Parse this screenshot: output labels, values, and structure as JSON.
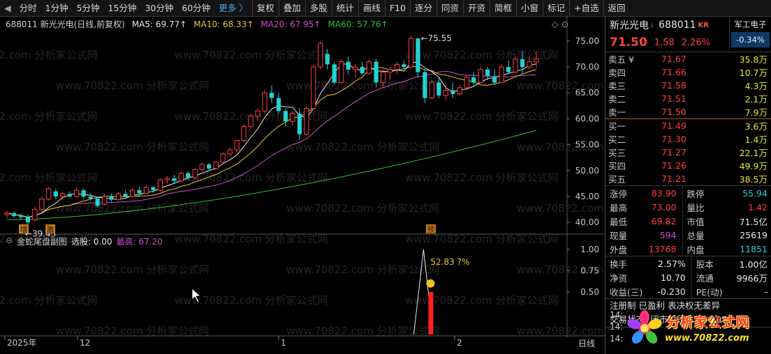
{
  "toolbar": {
    "items": [
      "分时",
      "1分钟",
      "5分钟",
      "15分钟",
      "30分钟",
      "60分钟",
      "更多 〉",
      "复权",
      "叠加",
      "多股",
      "统计",
      "画线",
      "F10",
      "逐分",
      "同资",
      "开资",
      "简框",
      "小窗",
      "标记",
      "+自选",
      "返回"
    ]
  },
  "legend": {
    "title": "688011 新光光电(日线,前复权)",
    "ma5": "MA5: 69.77↑",
    "ma10": "MA10: 68.33↑",
    "ma20": "MA20: 67.95↑",
    "ma60": "MA60: 57.76↑"
  },
  "sub_legend": {
    "name": "金蛇尾盘副图",
    "pick": "选股: 0.00",
    "high": "最高: 67.20"
  },
  "annotations": {
    "high": "75.55",
    "low": "39.43",
    "tag_zeng": "增",
    "tag_ji": "激",
    "tag_yu": "预",
    "sub_note": "52.83 ?%"
  },
  "price_axis": [
    "75.00",
    "70.00",
    "65.00",
    "60.00",
    "55.00",
    "50.00",
    "45.00",
    "40.00"
  ],
  "sub_axis": [
    "1.00",
    "0.75",
    "0.50"
  ],
  "x_axis": {
    "labels": [
      "2025年",
      "12",
      "1",
      "2"
    ],
    "period": "日线"
  },
  "stock": {
    "name": "新光光电",
    "code": "688011",
    "kr": "KR",
    "last": "71.50",
    "chg": "1.58",
    "pct": "2.26%",
    "sector": "军工电子",
    "sector_chg": "-0.34%"
  },
  "orderbook": {
    "asks": [
      {
        "label": "卖五 ¥",
        "price": "71.67",
        "vol": "35.8万"
      },
      {
        "label": "卖四",
        "price": "71.66",
        "vol": "10.7万"
      },
      {
        "label": "卖三",
        "price": "71.58",
        "vol": "4.3万"
      },
      {
        "label": "卖二",
        "price": "71.51",
        "vol": "2.1万"
      },
      {
        "label": "卖一",
        "price": "71.50",
        "vol": "7.9万"
      }
    ],
    "bids": [
      {
        "label": "买一",
        "price": "71.49",
        "vol": "3.6万"
      },
      {
        "label": "买二",
        "price": "71.30",
        "vol": "1.4万"
      },
      {
        "label": "买三",
        "price": "71.27",
        "vol": "22.1万"
      },
      {
        "label": "买四",
        "price": "71.26",
        "vol": "49.9万"
      },
      {
        "label": "买五",
        "price": "71.21",
        "vol": "38.5万"
      }
    ]
  },
  "stats": [
    [
      {
        "k": "涨停",
        "v": "83.90",
        "c": "red"
      },
      {
        "k": "跌停",
        "v": "55.94",
        "c": "green"
      }
    ],
    [
      {
        "k": "最高",
        "v": "73.00",
        "c": "red"
      },
      {
        "k": "量比",
        "v": "1.42",
        "c": "red"
      }
    ],
    [
      {
        "k": "最低",
        "v": "69.82",
        "c": "red"
      },
      {
        "k": "市值",
        "v": "71.5亿",
        "c": "white"
      }
    ],
    [
      {
        "k": "现量",
        "v": "594",
        "c": "purple"
      },
      {
        "k": "总量",
        "v": "25619",
        "c": "white"
      }
    ],
    [
      {
        "k": "外盘",
        "v": "13768",
        "c": "red"
      },
      {
        "k": "内盘",
        "v": "11851",
        "c": "green"
      }
    ]
  ],
  "stats2": [
    [
      {
        "k": "换手",
        "v": "2.57%",
        "c": "white"
      },
      {
        "k": "股本",
        "v": "1.00亿",
        "c": "white"
      }
    ],
    [
      {
        "k": "净资",
        "v": "10.70",
        "c": "white"
      },
      {
        "k": "流通",
        "v": "9966万",
        "c": "white"
      }
    ],
    [
      {
        "k": "收益(三)",
        "v": "-0.230",
        "c": "white"
      },
      {
        "k": "PE(动)",
        "v": "-",
        "c": "white"
      }
    ]
  ],
  "flags": "注册制 已盈利 表决权无差异",
  "trade_status": "交易状态: 闭市阶段 15:30:07",
  "trades": [
    "14:",
    "14:",
    "14:"
  ],
  "logo": {
    "brand": "分析家公式网",
    "url": "www.70822.com"
  },
  "watermark": "www.70822.com 分析家公式网",
  "colors": {
    "up": "#ff4040",
    "down": "#22d2d2",
    "ma5": "#e8e8e8",
    "ma10": "#e8c832",
    "ma20": "#d050d0",
    "ma60": "#30c030"
  },
  "chart_data": {
    "type": "candlestick",
    "ylim": [
      38,
      77
    ],
    "candles": [
      [
        41.5,
        42.2,
        40.8,
        41.8
      ],
      [
        41.8,
        42.0,
        41.0,
        41.2
      ],
      [
        41.2,
        41.8,
        40.6,
        41.0
      ],
      [
        41.0,
        41.5,
        39.4,
        40.0
      ],
      [
        40.5,
        43.0,
        40.2,
        42.5
      ],
      [
        42.5,
        45.0,
        42.0,
        44.5
      ],
      [
        44.5,
        46.8,
        44.2,
        46.5
      ],
      [
        46.0,
        46.5,
        44.5,
        45.0
      ],
      [
        45.0,
        45.8,
        44.3,
        45.5
      ],
      [
        45.5,
        46.0,
        44.8,
        45.0
      ],
      [
        45.0,
        46.8,
        44.8,
        46.2
      ],
      [
        46.2,
        46.5,
        44.6,
        45.0
      ],
      [
        45.0,
        45.6,
        44.2,
        44.6
      ],
      [
        44.6,
        45.0,
        42.8,
        43.2
      ],
      [
        43.5,
        45.5,
        43.2,
        45.0
      ],
      [
        45.0,
        45.6,
        44.0,
        44.4
      ],
      [
        44.4,
        45.8,
        44.2,
        45.5
      ],
      [
        45.5,
        46.2,
        44.8,
        45.0
      ],
      [
        45.0,
        46.5,
        44.8,
        46.2
      ],
      [
        46.2,
        46.8,
        45.2,
        45.6
      ],
      [
        45.6,
        47.2,
        45.4,
        46.8
      ],
      [
        46.8,
        47.0,
        45.8,
        46.2
      ],
      [
        46.2,
        48.5,
        46.0,
        48.2
      ],
      [
        48.2,
        49.0,
        47.5,
        48.5
      ],
      [
        48.5,
        49.2,
        47.6,
        48.0
      ],
      [
        48.0,
        49.8,
        47.8,
        49.5
      ],
      [
        49.5,
        49.8,
        48.2,
        48.6
      ],
      [
        48.6,
        50.5,
        48.4,
        50.2
      ],
      [
        50.2,
        51.5,
        49.8,
        51.2
      ],
      [
        51.2,
        51.5,
        50.0,
        50.4
      ],
      [
        50.4,
        51.8,
        50.2,
        51.6
      ],
      [
        51.6,
        53.5,
        51.4,
        53.2
      ],
      [
        53.2,
        54.5,
        52.8,
        54.0
      ],
      [
        54.0,
        56.0,
        53.5,
        55.8
      ],
      [
        55.8,
        59.0,
        55.5,
        58.5
      ],
      [
        58.5,
        61.0,
        58.0,
        60.5
      ],
      [
        60.5,
        62.0,
        59.5,
        61.5
      ],
      [
        61.5,
        65.5,
        61.0,
        65.0
      ],
      [
        65.0,
        66.5,
        63.0,
        64.0
      ],
      [
        64.0,
        65.0,
        61.0,
        61.5
      ],
      [
        61.5,
        62.0,
        58.5,
        59.5
      ],
      [
        59.5,
        61.5,
        58.8,
        61.0
      ],
      [
        61.0,
        62.0,
        56.0,
        57.0
      ],
      [
        57.0,
        62.5,
        56.8,
        62.0
      ],
      [
        62.0,
        70.5,
        61.8,
        70.0
      ],
      [
        70.0,
        75.0,
        69.5,
        74.5
      ],
      [
        72.5,
        73.5,
        69.5,
        70.5
      ],
      [
        70.5,
        71.0,
        66.5,
        67.0
      ],
      [
        67.0,
        71.5,
        66.8,
        71.0
      ],
      [
        71.0,
        72.0,
        68.5,
        69.5
      ],
      [
        69.5,
        70.5,
        68.0,
        70.0
      ],
      [
        70.0,
        71.0,
        68.5,
        68.8
      ],
      [
        68.8,
        71.5,
        68.5,
        71.0
      ],
      [
        71.0,
        71.5,
        66.0,
        67.0
      ],
      [
        67.0,
        69.5,
        66.0,
        69.0
      ],
      [
        69.0,
        70.0,
        67.5,
        69.5
      ],
      [
        69.5,
        71.0,
        68.5,
        70.5
      ],
      [
        70.5,
        71.2,
        69.5,
        70.0
      ],
      [
        70.0,
        76.0,
        69.8,
        75.5
      ],
      [
        75.5,
        75.55,
        68.0,
        69.0
      ],
      [
        69.0,
        69.5,
        63.0,
        64.0
      ],
      [
        64.0,
        67.5,
        63.8,
        67.0
      ],
      [
        67.0,
        68.0,
        64.0,
        64.5
      ],
      [
        64.5,
        66.5,
        63.5,
        65.5
      ],
      [
        65.5,
        67.0,
        64.0,
        64.8
      ],
      [
        64.8,
        66.5,
        64.5,
        66.0
      ],
      [
        66.0,
        68.5,
        65.5,
        68.0
      ],
      [
        68.0,
        69.0,
        66.5,
        67.0
      ],
      [
        67.0,
        70.0,
        66.8,
        69.5
      ],
      [
        69.5,
        70.0,
        67.5,
        68.2
      ],
      [
        68.2,
        69.5,
        66.5,
        67.0
      ],
      [
        67.0,
        70.5,
        66.8,
        70.0
      ],
      [
        70.0,
        71.2,
        68.5,
        69.0
      ],
      [
        69.0,
        72.0,
        68.8,
        71.5
      ],
      [
        71.5,
        73.0,
        68.5,
        70.0
      ],
      [
        70.0,
        71.8,
        69.5,
        71.0
      ],
      [
        71.0,
        73.0,
        69.82,
        71.5
      ]
    ],
    "ma60_start": 40.5,
    "ma60_end": 57.76,
    "signal": {
      "index": 60,
      "peak": 1.0,
      "bar": 0.5
    }
  }
}
